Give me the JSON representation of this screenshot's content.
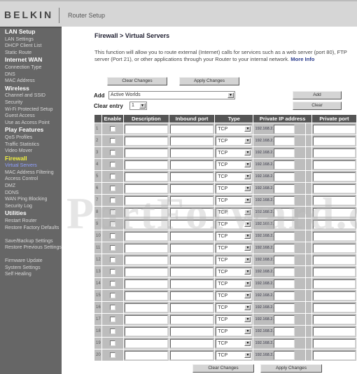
{
  "header": {
    "logo": "BELKIN",
    "title": "Router Setup"
  },
  "sidebar": {
    "items": [
      {
        "label": "LAN Setup",
        "type": "section"
      },
      {
        "label": "LAN Settings",
        "type": "link"
      },
      {
        "label": "DHCP Client List",
        "type": "link"
      },
      {
        "label": "Static Route",
        "type": "link"
      },
      {
        "label": "Internet WAN",
        "type": "section"
      },
      {
        "label": "Connection Type",
        "type": "link"
      },
      {
        "label": "DNS",
        "type": "link"
      },
      {
        "label": "MAC Address",
        "type": "link"
      },
      {
        "label": "Wireless",
        "type": "section"
      },
      {
        "label": "Channel and SSID",
        "type": "link"
      },
      {
        "label": "Security",
        "type": "link"
      },
      {
        "label": "Wi-Fi Protected Setup",
        "type": "link"
      },
      {
        "label": "Guest Access",
        "type": "link"
      },
      {
        "label": "Use as Access Point",
        "type": "link"
      },
      {
        "label": "Play Features",
        "type": "section"
      },
      {
        "label": "QoS Profiles",
        "type": "link"
      },
      {
        "label": "Traffic Statistics",
        "type": "link"
      },
      {
        "label": "Video Mover",
        "type": "link"
      },
      {
        "label": "Firewall",
        "type": "section-active"
      },
      {
        "label": "Virtual Servers",
        "type": "current"
      },
      {
        "label": "MAC Address Filtering",
        "type": "link"
      },
      {
        "label": "Access Control",
        "type": "link"
      },
      {
        "label": "DMZ",
        "type": "link"
      },
      {
        "label": "DDNS",
        "type": "link"
      },
      {
        "label": "WAN Ping Blocking",
        "type": "link"
      },
      {
        "label": "Security Log",
        "type": "link"
      },
      {
        "label": "Utilities",
        "type": "section"
      },
      {
        "label": "Restart Router",
        "type": "link"
      },
      {
        "label": "Restore Factory Defaults",
        "type": "link-wrap"
      },
      {
        "label": "Save/Backup Settings",
        "type": "link"
      },
      {
        "label": "Restore Previous Settings",
        "type": "link-wrap"
      },
      {
        "label": "Firmware Update",
        "type": "link"
      },
      {
        "label": "System Settings",
        "type": "link"
      },
      {
        "label": "Self Healing",
        "type": "link"
      }
    ]
  },
  "main": {
    "breadcrumb": "Firewall > Virtual Servers",
    "description": "This function will allow you to route external (Internet) calls for services such as a web server (port 80), FTP server (Port 21), or other applications through your Router to your internal network.",
    "more_info": "More Info",
    "clear_changes": "Clear Changes",
    "apply_changes": "Apply Changes",
    "add_label": "Add",
    "add_selected": "Active Worlds",
    "add_button": "Add",
    "clear_entry_label": "Clear entry",
    "clear_entry_selected": "1",
    "clear_button": "Clear",
    "watermark": "PortForward.com"
  },
  "table": {
    "headers": [
      "",
      "Enable",
      "Description",
      "Inbound port",
      "Type",
      "Private IP address",
      "Private port"
    ],
    "rows": [
      {
        "num": "1",
        "type": "TCP",
        "ip_prefix": "192.168.2."
      },
      {
        "num": "2",
        "type": "TCP",
        "ip_prefix": "192.168.2."
      },
      {
        "num": "3",
        "type": "TCP",
        "ip_prefix": "192.168.2."
      },
      {
        "num": "4",
        "type": "TCP",
        "ip_prefix": "192.168.2."
      },
      {
        "num": "5",
        "type": "TCP",
        "ip_prefix": "192.168.2."
      },
      {
        "num": "6",
        "type": "TCP",
        "ip_prefix": "192.168.2."
      },
      {
        "num": "7",
        "type": "TCP",
        "ip_prefix": "192.168.2."
      },
      {
        "num": "8",
        "type": "TCP",
        "ip_prefix": "192.168.2."
      },
      {
        "num": "9",
        "type": "TCP",
        "ip_prefix": "192.168.2."
      },
      {
        "num": "10",
        "type": "TCP",
        "ip_prefix": "192.168.2."
      },
      {
        "num": "11",
        "type": "TCP",
        "ip_prefix": "192.168.2."
      },
      {
        "num": "12",
        "type": "TCP",
        "ip_prefix": "192.168.2."
      },
      {
        "num": "13",
        "type": "TCP",
        "ip_prefix": "192.168.2."
      },
      {
        "num": "14",
        "type": "TCP",
        "ip_prefix": "192.168.2."
      },
      {
        "num": "15",
        "type": "TCP",
        "ip_prefix": "192.168.2."
      },
      {
        "num": "16",
        "type": "TCP",
        "ip_prefix": "192.168.2."
      },
      {
        "num": "17",
        "type": "TCP",
        "ip_prefix": "192.168.2."
      },
      {
        "num": "18",
        "type": "TCP",
        "ip_prefix": "192.168.2."
      },
      {
        "num": "19",
        "type": "TCP",
        "ip_prefix": "192.168.2."
      },
      {
        "num": "20",
        "type": "TCP",
        "ip_prefix": "192.168.2."
      }
    ]
  },
  "colors": {
    "sidebar_bg": "#666666",
    "header_bg": "#d6d6d6",
    "active_section": "#f0f040",
    "current_link": "#8fa0ff",
    "table_header": "#555555",
    "table_cell": "#bdbdbd",
    "link": "#2a3c8c"
  }
}
